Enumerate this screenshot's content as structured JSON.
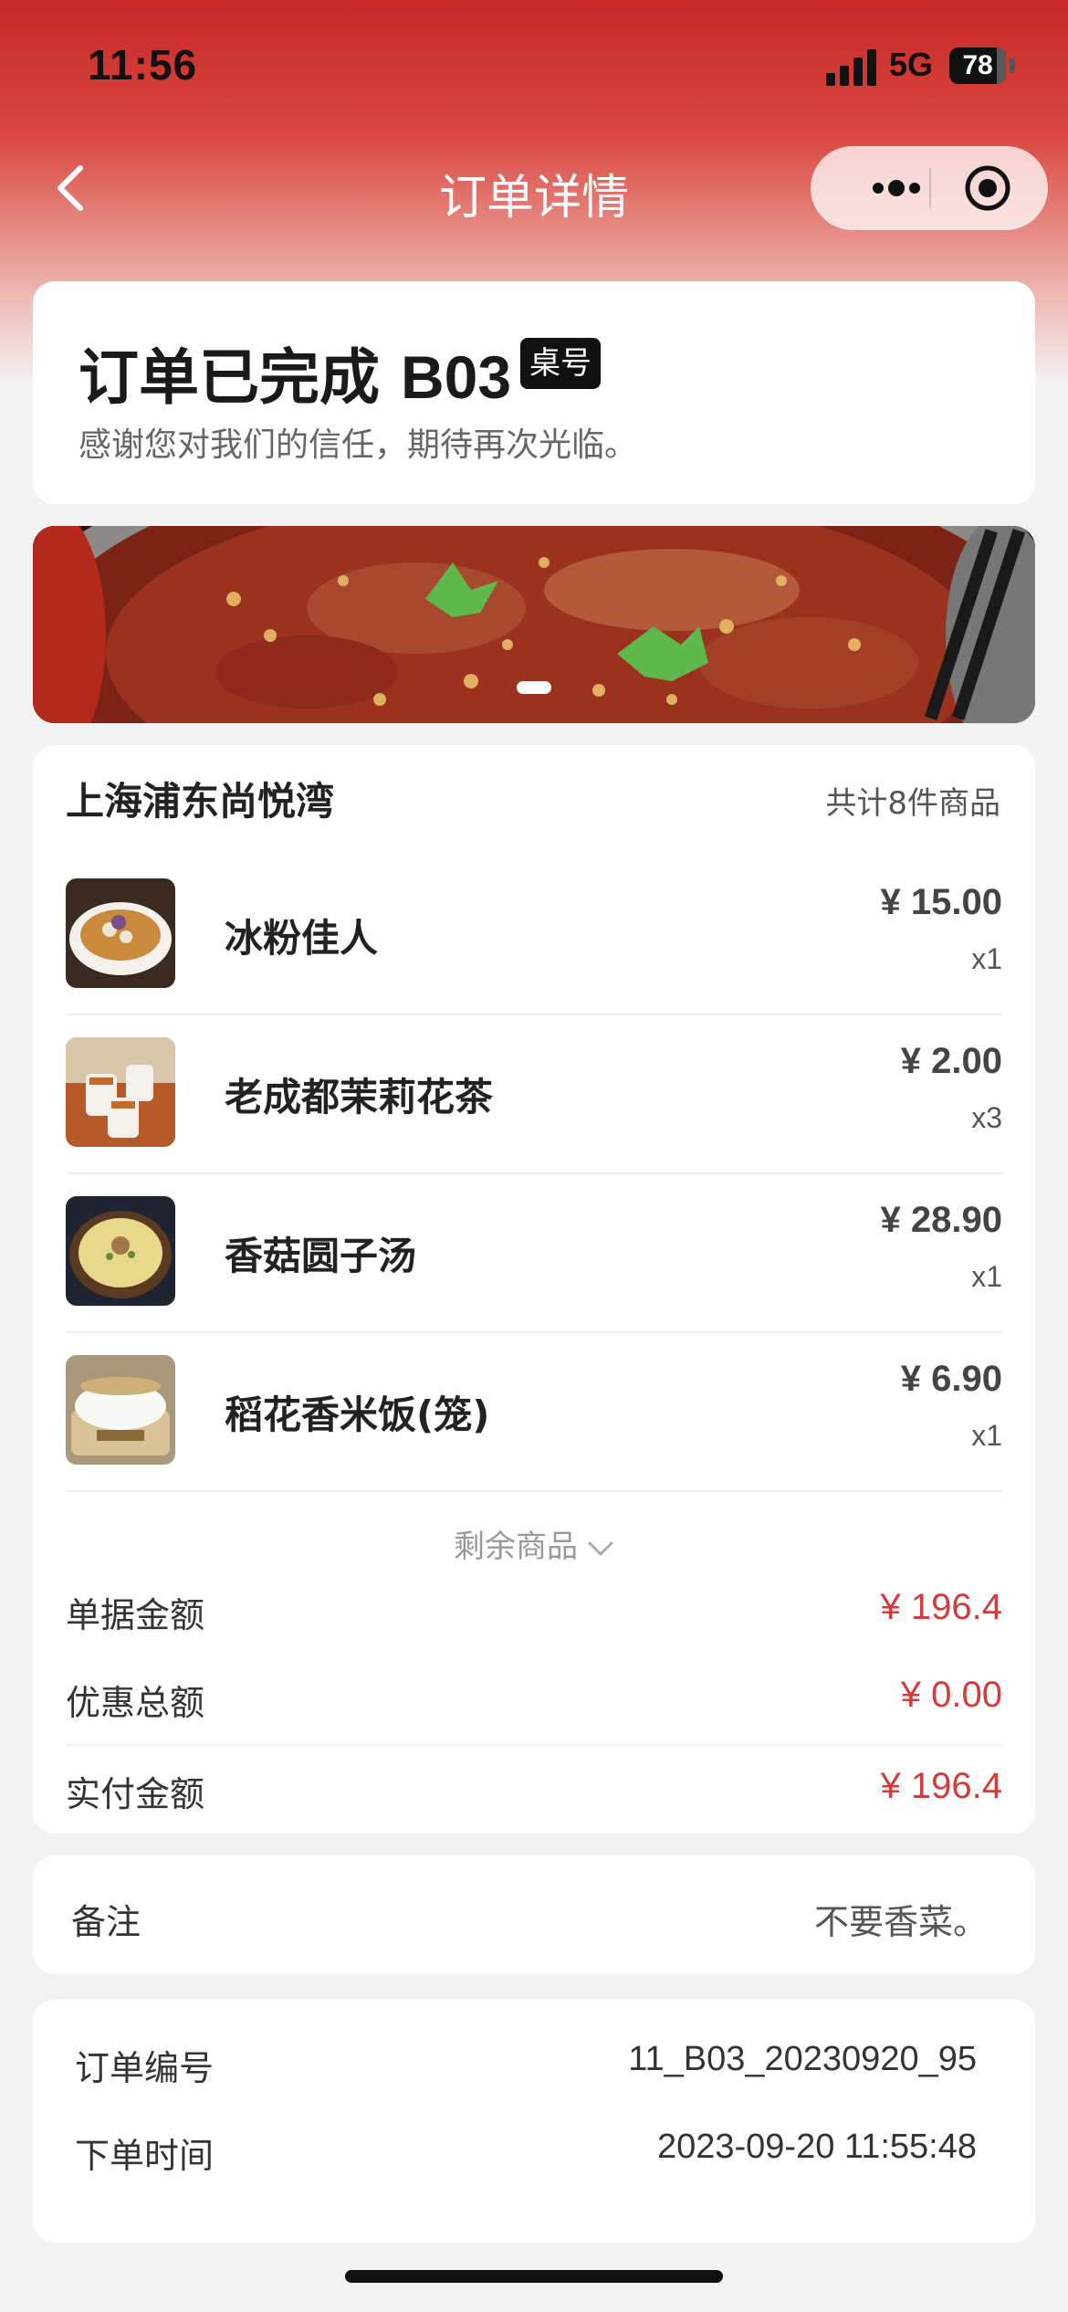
{
  "status_bar": {
    "time": "11:56",
    "network": "5G",
    "battery": "78"
  },
  "nav": {
    "title": "订单详情",
    "back_icon": "chevron-left-icon",
    "more_icon": "more-dots-icon",
    "close_icon": "target-circle-icon"
  },
  "order_status": {
    "title": "订单已完成",
    "table_no": "B03",
    "badge": "桌号",
    "subtitle": "感谢您对我们的信任，期待再次光临。"
  },
  "store": {
    "name": "上海浦东尚悦湾",
    "item_count": "共计8件商品"
  },
  "items": [
    {
      "name": "冰粉佳人",
      "price": "¥ 15.00",
      "qty": "x1"
    },
    {
      "name": "老成都茉莉花茶",
      "price": "¥ 2.00",
      "qty": "x3"
    },
    {
      "name": "香菇圆子汤",
      "price": "¥ 28.90",
      "qty": "x1"
    },
    {
      "name": "稻花香米饭(笼)",
      "price": "¥ 6.90",
      "qty": "x1"
    }
  ],
  "more_label": "剩余商品",
  "summary": {
    "bill_label": "单据金额",
    "bill_value": "¥ 196.4",
    "discount_label": "优惠总额",
    "discount_value": "¥ 0.00",
    "paid_label": "实付金额",
    "paid_value": "¥ 196.4"
  },
  "remark": {
    "label": "备注",
    "value": "不要香菜。"
  },
  "order_info": {
    "number_label": "订单编号",
    "number_value": "11_B03_20230920_95",
    "time_label": "下单时间",
    "time_value": "2023-09-20 11:55:48"
  },
  "colors": {
    "accent_red": "#d4393b",
    "header_red": "#c62828"
  }
}
